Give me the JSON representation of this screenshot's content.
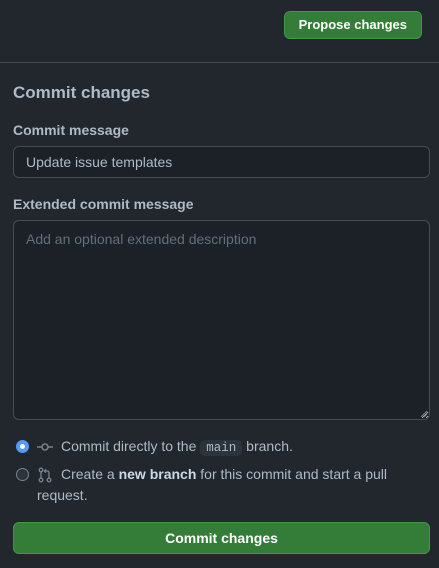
{
  "header": {
    "propose_label": "Propose changes"
  },
  "commit": {
    "title": "Commit changes",
    "message_label": "Commit message",
    "message_value": "Update issue templates",
    "extended_label": "Extended commit message",
    "extended_placeholder": "Add an optional extended description",
    "options": {
      "direct": {
        "prefix": "Commit directly to the",
        "branch": "main",
        "suffix": "branch.",
        "checked": true,
        "icon": "git-commit-icon"
      },
      "new_branch": {
        "prefix": "Create a",
        "bold": "new branch",
        "suffix": "for this commit and start a pull",
        "line2": "request.",
        "checked": false,
        "icon": "git-pull-request-icon"
      }
    },
    "button_label": "Commit changes"
  },
  "colors": {
    "background": "#22272e",
    "button_green": "#347d39",
    "radio_blue": "#539bf5",
    "text": "#adbac7"
  }
}
